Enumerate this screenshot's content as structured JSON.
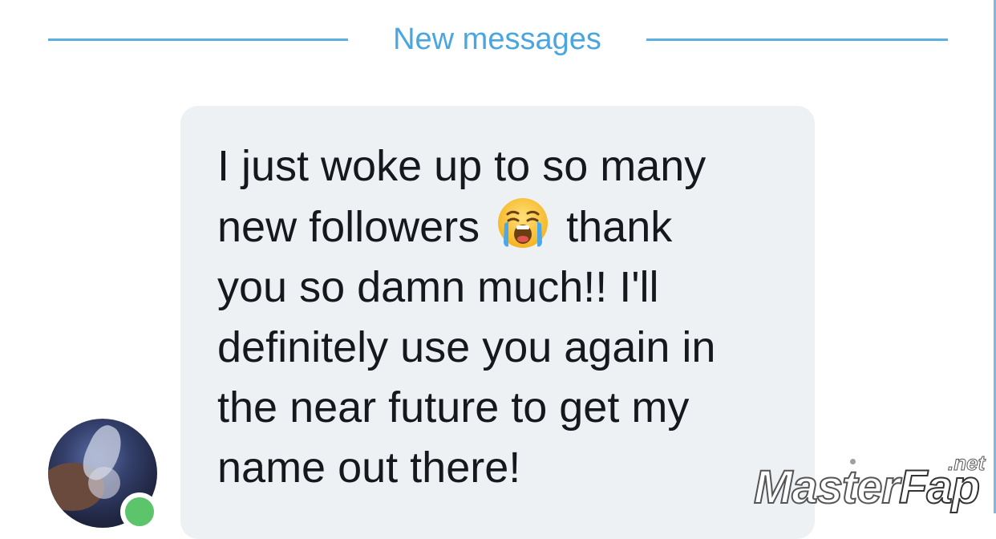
{
  "divider": {
    "label": "New messages"
  },
  "message": {
    "text_before_emoji": "I just woke up to so many\nnew followers",
    "emoji": "loudly-crying-face-icon",
    "text_after_emoji": "thank\nyou so damn much!! I'll\ndefinitely use you again in\nthe near future to get my\nname out there!"
  },
  "sender": {
    "online": true
  },
  "watermark": {
    "main_part1": "Master",
    "main_part2": "Fap",
    "suffix": ".net"
  },
  "colors": {
    "accent": "#4aa6e0",
    "bubble": "#eef1f4",
    "online": "#5cc46a"
  }
}
